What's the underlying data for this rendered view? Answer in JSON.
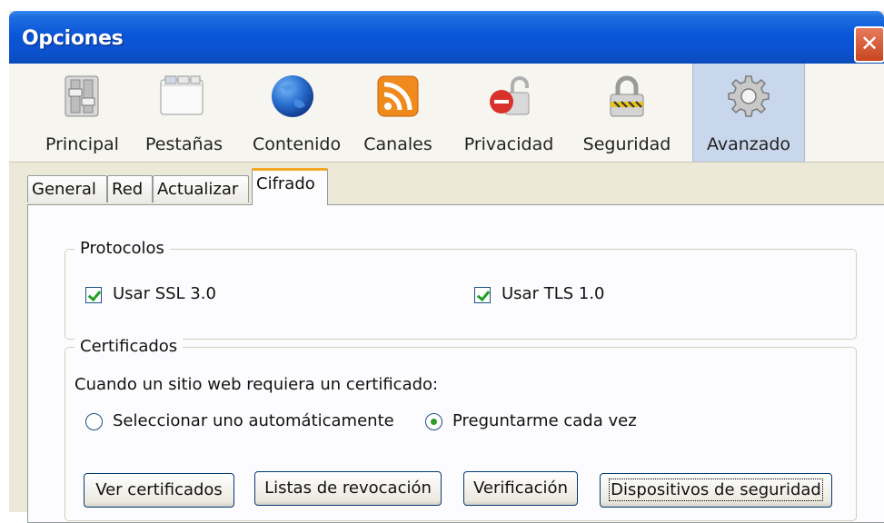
{
  "window": {
    "title": "Opciones",
    "close_glyph": "✕"
  },
  "toolbar": {
    "items": [
      {
        "label": "Principal",
        "icon": "switch-icon"
      },
      {
        "label": "Pestañas",
        "icon": "tabs-icon"
      },
      {
        "label": "Contenido",
        "icon": "globe-icon"
      },
      {
        "label": "Canales",
        "icon": "rss-icon"
      },
      {
        "label": "Privacidad",
        "icon": "privacy-lock-icon"
      },
      {
        "label": "Seguridad",
        "icon": "padlock-icon"
      },
      {
        "label": "Avanzado",
        "icon": "gear-icon",
        "selected": true
      }
    ]
  },
  "tabs": [
    {
      "label": "General"
    },
    {
      "label": "Red"
    },
    {
      "label": "Actualizar"
    },
    {
      "label": "Cifrado",
      "active": true
    }
  ],
  "protocols": {
    "legend": "Protocolos",
    "ssl": {
      "label": "Usar SSL 3.0",
      "checked": true
    },
    "tls": {
      "label": "Usar TLS 1.0",
      "checked": true
    }
  },
  "certificates": {
    "legend": "Certificados",
    "prompt": "Cuando un sitio web requiera un certificado:",
    "auto": {
      "label": "Seleccionar uno automáticamente",
      "selected": false
    },
    "ask": {
      "label": "Preguntarme cada vez",
      "selected": true
    },
    "buttons": {
      "view": "Ver certificados",
      "revocation": "Listas de revocación",
      "verification": "Verificación",
      "devices": "Dispositivos de seguridad"
    }
  },
  "colors": {
    "titlebar": "#0a55d8",
    "selected_toolbar": "#c9d7ec",
    "active_tab_accent": "#f5a623",
    "checkmark": "#21a121"
  }
}
